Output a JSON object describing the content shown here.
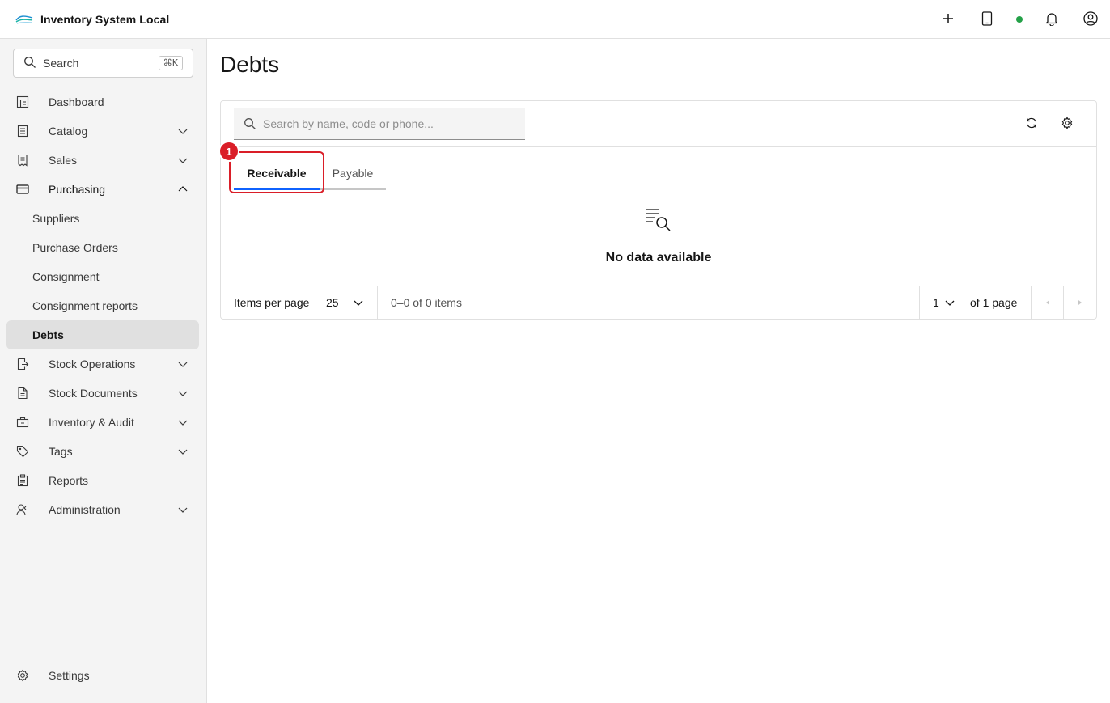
{
  "header": {
    "app_title": "Inventory System Local",
    "icons": [
      "add-icon",
      "tablet-icon",
      "notification-icon",
      "user-avatar-icon"
    ],
    "status_color": "#24a148"
  },
  "sidebar": {
    "search": {
      "label": "Search",
      "shortcut": "⌘K"
    },
    "items": [
      {
        "label": "Dashboard",
        "icon": "dashboard-icon"
      },
      {
        "label": "Catalog",
        "icon": "catalog-icon",
        "expandable": true
      },
      {
        "label": "Sales",
        "icon": "sales-icon",
        "expandable": true
      },
      {
        "label": "Purchasing",
        "icon": "purchasing-icon",
        "expandable": true,
        "expanded": true,
        "children": [
          {
            "label": "Suppliers"
          },
          {
            "label": "Purchase Orders"
          },
          {
            "label": "Consignment"
          },
          {
            "label": "Consignment reports"
          },
          {
            "label": "Debts",
            "active": true
          }
        ]
      },
      {
        "label": "Stock Operations",
        "icon": "stock-operations-icon",
        "expandable": true
      },
      {
        "label": "Stock Documents",
        "icon": "document-icon",
        "expandable": true
      },
      {
        "label": "Inventory & Audit",
        "icon": "inventory-audit-icon",
        "expandable": true
      },
      {
        "label": "Tags",
        "icon": "tag-icon",
        "expandable": true
      },
      {
        "label": "Reports",
        "icon": "report-icon"
      },
      {
        "label": "Administration",
        "icon": "administration-icon",
        "expandable": true
      }
    ],
    "settings_label": "Settings"
  },
  "main": {
    "title": "Debts",
    "search": {
      "placeholder": "Search by name, code or phone..."
    },
    "tabs": [
      {
        "label": "Receivable",
        "selected": true
      },
      {
        "label": "Payable",
        "selected": false
      }
    ],
    "annotation_badge": "1",
    "empty_state": {
      "text": "No data available"
    },
    "pagination": {
      "items_per_page_label": "Items per page",
      "page_size": "25",
      "range_text": "0–0 of 0 items",
      "current_page": "1",
      "of_pages_text": "of 1 page"
    }
  },
  "colors": {
    "accent": "#0f62fe",
    "highlight": "#da1e28",
    "sidebar_bg": "#f4f4f4"
  }
}
